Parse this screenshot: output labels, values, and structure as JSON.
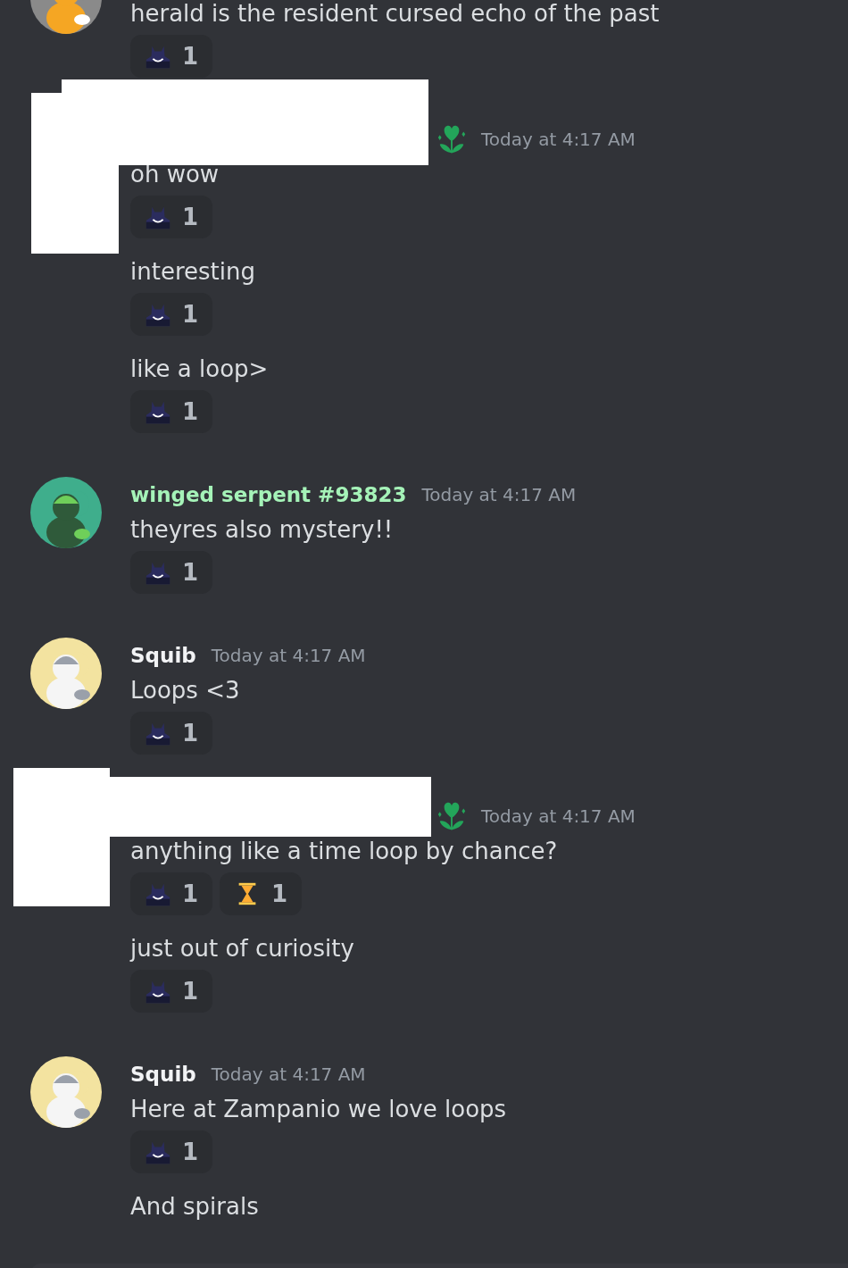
{
  "groups": [
    {
      "messages": [
        {
          "text": "herald is the resident cursed echo of the past",
          "reactions": [
            {
              "kind": "cat",
              "count": "1"
            }
          ]
        }
      ]
    },
    {
      "author": {
        "redacted": true,
        "badge": true
      },
      "timestamp": "Today at 4:17 AM",
      "messages": [
        {
          "text": "oh wow",
          "reactions": [
            {
              "kind": "cat",
              "count": "1"
            }
          ]
        },
        {
          "text": "interesting",
          "reactions": [
            {
              "kind": "cat",
              "count": "1"
            }
          ]
        },
        {
          "text": "like a loop>",
          "reactions": [
            {
              "kind": "cat",
              "count": "1"
            }
          ]
        }
      ]
    },
    {
      "author": {
        "name": "winged serpent #93823",
        "color": "#a5f3b8",
        "redacted": false,
        "badge": false
      },
      "timestamp": "Today at 4:17 AM",
      "messages": [
        {
          "text": "theyres also mystery!!",
          "reactions": [
            {
              "kind": "cat",
              "count": "1"
            }
          ]
        }
      ]
    },
    {
      "author": {
        "name": "Squib",
        "color": "#f2f3f5",
        "redacted": false,
        "badge": false
      },
      "timestamp": "Today at 4:17 AM",
      "messages": [
        {
          "text": "Loops <3",
          "reactions": [
            {
              "kind": "cat",
              "count": "1"
            }
          ]
        }
      ]
    },
    {
      "author": {
        "redacted": true,
        "badge": true
      },
      "timestamp": "Today at 4:17 AM",
      "messages": [
        {
          "text": "anything like a time loop by chance?",
          "reactions": [
            {
              "kind": "cat",
              "count": "1"
            },
            {
              "kind": "hourglass",
              "count": "1"
            }
          ]
        },
        {
          "text": "just out of curiosity",
          "reactions": [
            {
              "kind": "cat",
              "count": "1"
            }
          ]
        }
      ]
    },
    {
      "author": {
        "name": "Squib",
        "color": "#f2f3f5",
        "redacted": false,
        "badge": false
      },
      "timestamp": "Today at 4:17 AM",
      "messages": [
        {
          "text": "Here at Zampanio we love loops",
          "reactions": [
            {
              "kind": "cat",
              "count": "1"
            }
          ]
        },
        {
          "text": "And spirals"
        }
      ]
    }
  ],
  "composer": {
    "kind": "message-bar"
  }
}
